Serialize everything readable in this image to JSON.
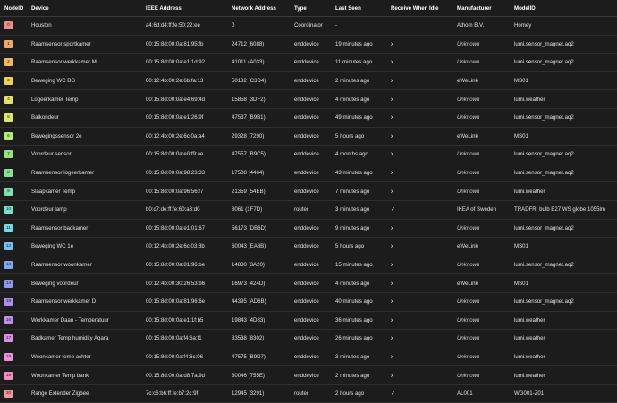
{
  "columns": [
    "NodeID",
    "Device",
    "IEEE Address",
    "Network Address",
    "Type",
    "Last Seen",
    "Receive When Idle",
    "Manufacturer",
    "ModelID"
  ],
  "rows": [
    {
      "id": "0",
      "color": "#f08a8a",
      "device": "Houston",
      "ieee": "a4:6d:d4:ff:fe:50:22:ee",
      "network": "0",
      "type": "Coordinator",
      "last_seen": "-",
      "idle": "",
      "manufacturer": "Athom B.V.",
      "model": "Homey",
      "italic": false
    },
    {
      "id": "1",
      "color": "#f0a868",
      "device": "Raamsensor sportkamer",
      "ieee": "00:15:8d:00:0a:81:95:fb",
      "network": "24712 (6088)",
      "type": "enddevice",
      "last_seen": "19 minutes ago",
      "idle": "x",
      "manufacturer": "Unknown",
      "model": "lumi.sensor_magnet.aq2",
      "italic": true
    },
    {
      "id": "2",
      "color": "#f0b868",
      "device": "Raamsensor werkkamer M",
      "ieee": "00:15:8d:00:0a:e1:1d:92",
      "network": "41011 (A033)",
      "type": "enddevice",
      "last_seen": "11 minutes ago",
      "idle": "x",
      "manufacturer": "Unknown",
      "model": "lumi.sensor_magnet.aq2",
      "italic": true
    },
    {
      "id": "3",
      "color": "#f0d05a",
      "device": "Beweging WC BG",
      "ieee": "00:12:4b:00:2e:6b:fa:13",
      "network": "50132 (C3D4)",
      "type": "enddevice",
      "last_seen": "2 minutes ago",
      "idle": "x",
      "manufacturer": "eWeLink",
      "model": "MS01",
      "italic": false
    },
    {
      "id": "4",
      "color": "#e6e070",
      "device": "Logeerkamer Temp",
      "ieee": "00:15:8d:00:0a:e4:69:4d",
      "network": "15858 (3DF2)",
      "type": "enddevice",
      "last_seen": "4 minutes ago",
      "idle": "x",
      "manufacturer": "Unknown",
      "model": "lumi.weather",
      "italic": true
    },
    {
      "id": "5",
      "color": "#d8e870",
      "device": "Balkondeur",
      "ieee": "00:15:8d:00:0a:e1:26:9f",
      "network": "47537 (B9B1)",
      "type": "enddevice",
      "last_seen": "49 minutes ago",
      "idle": "x",
      "manufacturer": "Unknown",
      "model": "lumi.sensor_magnet.aq2",
      "italic": true
    },
    {
      "id": "6",
      "color": "#b8e878",
      "device": "Bewegingssensor 2e",
      "ieee": "00:12:4b:00:2e:6c:0a:a4",
      "network": "29328 (7290)",
      "type": "enddevice",
      "last_seen": "5 hours ago",
      "idle": "x",
      "manufacturer": "eWeLink",
      "model": "MS01",
      "italic": false
    },
    {
      "id": "7",
      "color": "#98e080",
      "device": "Voordeur sensor",
      "ieee": "00:15:8d:00:0a:e0:f9:ae",
      "network": "47557 (B9C5)",
      "type": "enddevice",
      "last_seen": "4 months ago",
      "idle": "x",
      "manufacturer": "Unknown",
      "model": "lumi.sensor_magnet.aq2",
      "italic": true
    },
    {
      "id": "8",
      "color": "#88e098",
      "device": "Raamsensor logeerkamer",
      "ieee": "00:15:8d:00:0a:98:23:33",
      "network": "17508 (4464)",
      "type": "enddevice",
      "last_seen": "43 minutes ago",
      "idle": "x",
      "manufacturer": "Unknown",
      "model": "lumi.sensor_magnet.aq2",
      "italic": true
    },
    {
      "id": "9",
      "color": "#80e0b0",
      "device": "Slaapkamer Temp",
      "ieee": "00:15:8d:00:0a:96:56:f7",
      "network": "21359 (54EB)",
      "type": "enddevice",
      "last_seen": "7 minutes ago",
      "idle": "x",
      "manufacturer": "Unknown",
      "model": "lumi.weather",
      "italic": true
    },
    {
      "id": "10",
      "color": "#78e0d0",
      "device": "Voordeur lamp",
      "ieee": "b0:c7:de:ff:fe:60:a8:d0",
      "network": "8061 (1F7D)",
      "type": "router",
      "last_seen": "3 minutes ago",
      "idle": "✓",
      "manufacturer": "IKEA of Sweden",
      "model": "TRADFRI bulb E27 WS globe 1055lm",
      "italic": false
    },
    {
      "id": "11",
      "color": "#78d8e8",
      "device": "Raamsensor badkamer",
      "ieee": "00:15:8d:00:0a:e1:01:67",
      "network": "56173 (DB6D)",
      "type": "enddevice",
      "last_seen": "9 minutes ago",
      "idle": "x",
      "manufacturer": "Unknown",
      "model": "lumi.sensor_magnet.aq2",
      "italic": true
    },
    {
      "id": "12",
      "color": "#78c0f0",
      "device": "Beweging WC 1e",
      "ieee": "00:12:4b:00:2e:6c:03:8b",
      "network": "60043 (EA8B)",
      "type": "enddevice",
      "last_seen": "5 hours ago",
      "idle": "x",
      "manufacturer": "eWeLink",
      "model": "MS01",
      "italic": false
    },
    {
      "id": "13",
      "color": "#80a8f0",
      "device": "Raamsensor woonkamer",
      "ieee": "00:15:8d:00:0a:81:96:be",
      "network": "14880 (3A20)",
      "type": "enddevice",
      "last_seen": "15 minutes ago",
      "idle": "x",
      "manufacturer": "Unknown",
      "model": "lumi.sensor_magnet.aq2",
      "italic": true
    },
    {
      "id": "14",
      "color": "#9098f0",
      "device": "Beweging voordeur",
      "ieee": "00:12:4b:00:30:26:53:b6",
      "network": "16973 (424D)",
      "type": "enddevice",
      "last_seen": "4 minutes ago",
      "idle": "x",
      "manufacturer": "eWeLink",
      "model": "MS01",
      "italic": false
    },
    {
      "id": "15",
      "color": "#a890f0",
      "device": "Raamsensor werkkamer D",
      "ieee": "00:15:8d:00:0a:81:96:6e",
      "network": "44395 (AD6B)",
      "type": "enddevice",
      "last_seen": "40 minutes ago",
      "idle": "x",
      "manufacturer": "Unknown",
      "model": "lumi.sensor_magnet.aq2",
      "italic": true
    },
    {
      "id": "16",
      "color": "#c090f0",
      "device": "Werkkamer Daan - Temperatuur",
      "ieee": "00:15:8d:00:0a:e1:1f:b5",
      "network": "19843 (4D83)",
      "type": "enddevice",
      "last_seen": "36 minutes ago",
      "idle": "x",
      "manufacturer": "Unknown",
      "model": "lumi.weather",
      "italic": true
    },
    {
      "id": "17",
      "color": "#d890e8",
      "device": "Badkamer Temp humidity Aqara",
      "ieee": "00:15:8d:00:0a:f4:6a:f1",
      "network": "33538 (8302)",
      "type": "enddevice",
      "last_seen": "26 minutes ago",
      "idle": "x",
      "manufacturer": "Unknown",
      "model": "lumi.weather",
      "italic": true
    },
    {
      "id": "18",
      "color": "#e890d8",
      "device": "Woonkamer temp achter",
      "ieee": "00:15:8d:00:0a:f4:6c:06",
      "network": "47575 (B9D7)",
      "type": "enddevice",
      "last_seen": "3 minutes ago",
      "idle": "x",
      "manufacturer": "Unknown",
      "model": "lumi.weather",
      "italic": true
    },
    {
      "id": "19",
      "color": "#f090c0",
      "device": "Woonkamer Temp bank",
      "ieee": "00:15:8d:00:0a:d8:7a:9d",
      "network": "30046 (755E)",
      "type": "enddevice",
      "last_seen": "2 minutes ago",
      "idle": "x",
      "manufacturer": "Unknown",
      "model": "lumi.weather",
      "italic": true
    },
    {
      "id": "20",
      "color": "#f098a0",
      "device": "Range Extender Zigbee",
      "ieee": "7c:c6:b6:ff:fe:b7:2c:9f",
      "network": "12945 (3291)",
      "type": "router",
      "last_seen": "2 hours ago",
      "idle": "✓",
      "manufacturer": "AL001",
      "model": "WG001-Z01",
      "italic": false
    }
  ]
}
